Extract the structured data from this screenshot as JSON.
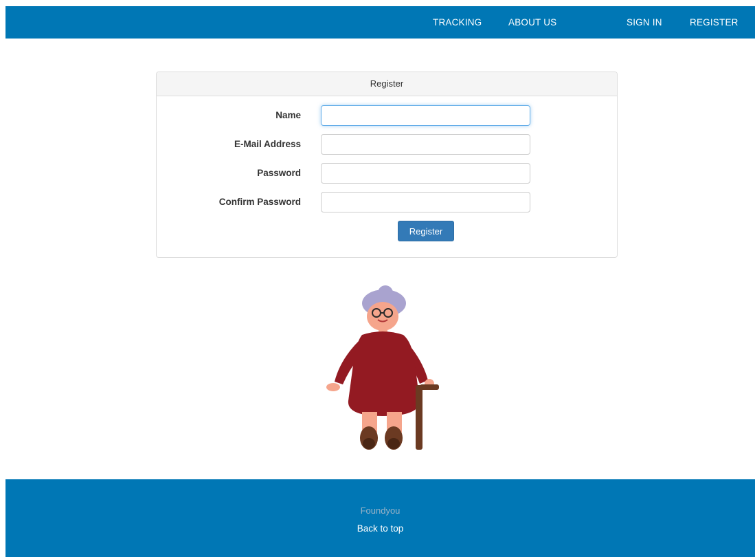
{
  "nav": {
    "tracking": "TRACKING",
    "about_us": "ABOUT US",
    "sign_in": "SIGN IN",
    "register": "REGISTER"
  },
  "panel": {
    "heading": "Register",
    "fields": {
      "name": {
        "label": "Name",
        "value": ""
      },
      "email": {
        "label": "E-Mail Address",
        "value": ""
      },
      "password": {
        "label": "Password",
        "value": ""
      },
      "confirm_password": {
        "label": "Confirm Password",
        "value": ""
      }
    },
    "submit_label": "Register"
  },
  "illustration": {
    "icon": "elderly-woman-with-cane-illustration"
  },
  "footer": {
    "brand": "Foundyou",
    "back_to_top": "Back to top"
  },
  "colors": {
    "brand_blue": "#0077b5",
    "button_blue": "#337ab7",
    "dress": "#931a22",
    "hair": "#a9a3cf",
    "skin": "#f5a58c",
    "cane": "#6b3a22"
  }
}
